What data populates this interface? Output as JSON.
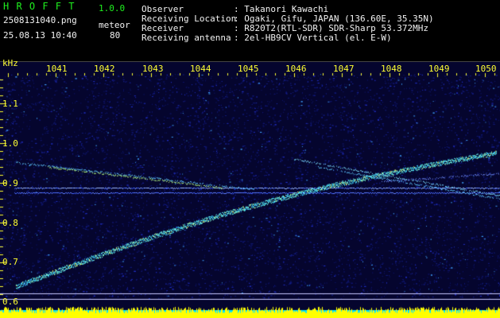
{
  "header": {
    "app_name": "H R O F F T",
    "version": "1.0.0",
    "file_name": "2508131040.png",
    "mode": "meteor",
    "datetime": "25.08.13 10:40",
    "count": "80",
    "info": [
      {
        "label": "Observer",
        "value": ": Takanori Kawachi"
      },
      {
        "label": "Receiving Location",
        "value": ": Ogaki, Gifu, JAPAN (136.60E, 35.35N)"
      },
      {
        "label": "Receiver",
        "value": ": R820T2(RTL-SDR) SDR-Sharp 53.372MHz"
      },
      {
        "label": "Receiving antenna",
        "value": ": 2el-HB9CV Vertical (el. E-W)"
      }
    ]
  },
  "spectrogram": {
    "y_unit": "kHz",
    "y_ticks": [
      "1.1",
      "1.0",
      "0.9",
      "0.8",
      "0.7",
      "0.6"
    ],
    "x_ticks": [
      "1041",
      "1042",
      "1043",
      "1044",
      "1045",
      "1046",
      "1047",
      "1048",
      "1049",
      "1050"
    ],
    "colors": {
      "axis": "#ffff33",
      "background": "#05052e",
      "trace": "#7fffd4",
      "noise": "#2a3cff",
      "bottom_bar": "#ffff00",
      "bottom_bar_alt": "#00e5ff"
    }
  }
}
